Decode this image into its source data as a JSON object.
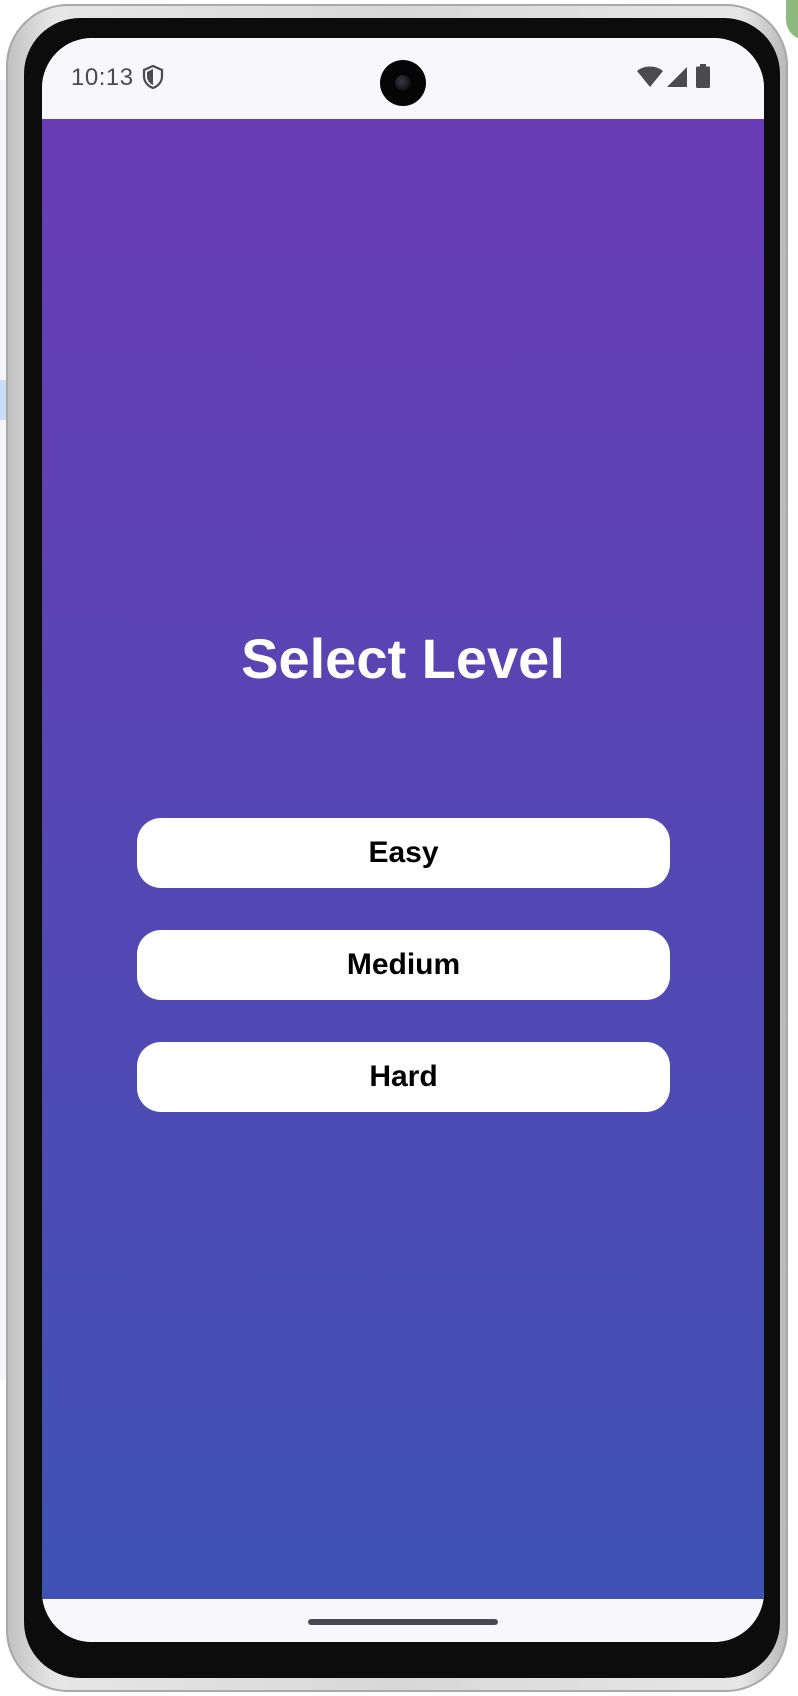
{
  "status_bar": {
    "time": "10:13",
    "icons": [
      "shield-icon",
      "wifi-icon",
      "signal-icon",
      "battery-icon"
    ]
  },
  "screen": {
    "title": "Select Level",
    "levels": [
      {
        "label": "Easy"
      },
      {
        "label": "Medium"
      },
      {
        "label": "Hard"
      }
    ]
  },
  "colors": {
    "gradient_top": "#683cb5",
    "gradient_bottom": "#3f52b4",
    "button_bg": "#ffffff",
    "button_text": "#000000",
    "title_text": "#ffffff"
  }
}
